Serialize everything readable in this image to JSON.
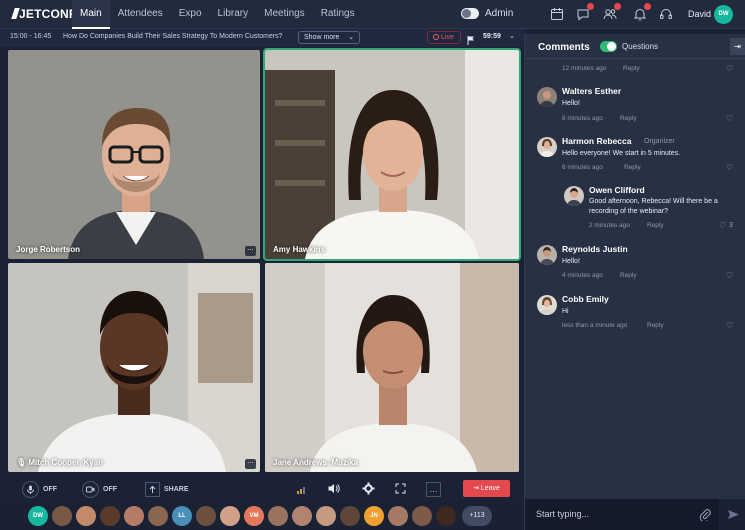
{
  "brand": {
    "logo": "JETCONF"
  },
  "nav": {
    "tabs": [
      "Main",
      "Attendees",
      "Expo",
      "Library",
      "Meetings",
      "Ratings"
    ],
    "active_tab": "Main",
    "admin_label": "Admin",
    "icons": [
      "calendar-icon",
      "chat-icon",
      "users-icon",
      "bell-icon",
      "headset-icon"
    ],
    "user_name": "David",
    "user_initials": "DW"
  },
  "session": {
    "time": "15:00 - 16:45",
    "title": "How Do Companies Build Their Sales Strategy To Modern Customers?",
    "show_more": "Show more",
    "live": "Live",
    "timer": "59:59"
  },
  "tiles": [
    {
      "name": "Jorge Robertson"
    },
    {
      "name": "Amy Hawkins"
    },
    {
      "name": "Mitch Cooper, Kyan"
    },
    {
      "name": "Jane Andrews, Muzika"
    }
  ],
  "controls": {
    "mic_state": "OFF",
    "cam_state": "OFF",
    "share": "SHARE",
    "leave": "Leave"
  },
  "participants": {
    "initials": [
      "DW",
      "LL",
      "VM",
      "JN"
    ],
    "more": "+113"
  },
  "comments": {
    "title": "Comments",
    "toggle_label": "Questions",
    "input_placeholder": "Start typing...",
    "items": [
      {
        "meta": "12 minutes ago",
        "reply": "Reply"
      },
      {
        "author": "Walters Esther",
        "text": "Hello!",
        "meta": "8 minutes ago",
        "reply": "Reply"
      },
      {
        "author": "Harmon Rebecca",
        "role": "Organizer",
        "text": "Hello everyone! We start in 5 minutes.",
        "meta": "6 minutes ago",
        "reply": "Reply"
      },
      {
        "author": "Owen Clifford",
        "text_line1": "Good afternoon, Rebecca! Will there be a",
        "text_line2": "recording of the webinar?",
        "meta": "2 minutes ago",
        "reply": "Reply",
        "likes": "3"
      },
      {
        "author": "Reynolds Justin",
        "text": "Hello!",
        "meta": "4 minutes ago",
        "reply": "Reply"
      },
      {
        "author": "Cobb Emily",
        "text": "Hi",
        "meta": "less than a minute ago",
        "reply": "Reply"
      }
    ]
  },
  "colors": {
    "accent_green": "#2fba74",
    "leave_red": "#e5484d",
    "avatar_teal": "#18b8a0"
  }
}
